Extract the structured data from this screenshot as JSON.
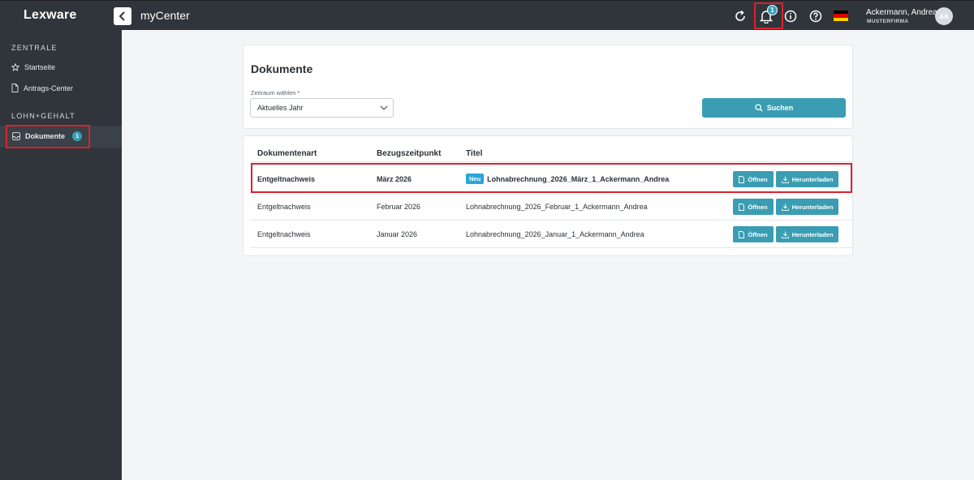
{
  "topbar": {
    "logo": "Lexware",
    "app_title": "myCenter",
    "notification_count": "1",
    "user_name": "Ackermann, Andrea",
    "user_company": "MUSTERFIRMA",
    "avatar_initials": "AA",
    "icons": [
      "back-icon",
      "refresh-icon",
      "bell-icon",
      "info-icon",
      "help-icon",
      "german-flag-icon"
    ]
  },
  "sidebar": {
    "section1_title": "ZENTRALE",
    "item_startseite": "Startseite",
    "item_antrags": "Antrags-Center",
    "section2_title": "LOHN+GEHALT",
    "item_dokumente": "Dokumente",
    "dokumente_badge": "1"
  },
  "filter": {
    "title": "Dokumente",
    "label": "Zeitraum wählen",
    "required_mark": "*",
    "selected": "Aktuelles Jahr",
    "search_label": "Suchen"
  },
  "table": {
    "headers": [
      "Dokumentenart",
      "Bezugszeitpunkt",
      "Titel"
    ],
    "new_badge": "Neu",
    "open_label": "Öffnen",
    "download_label": "Herunterladen",
    "rows": [
      {
        "type": "Entgeltnachweis",
        "date": "März 2026",
        "title": "Lohnabrechnung_2026_März_1_Ackermann_Andrea"
      },
      {
        "type": "Entgeltnachweis",
        "date": "Februar 2026",
        "title": "Lohnabrechnung_2026_Februar_1_Ackermann_Andrea"
      },
      {
        "type": "Entgeltnachweis",
        "date": "Januar 2026",
        "title": "Lohnabrechnung_2026_Januar_1_Ackermann_Andrea"
      }
    ]
  },
  "colors": {
    "topbar": "#2f353b",
    "accent": "#3a9db3",
    "highlight": "#d9232e",
    "new_badge": "#2aa6d8"
  }
}
